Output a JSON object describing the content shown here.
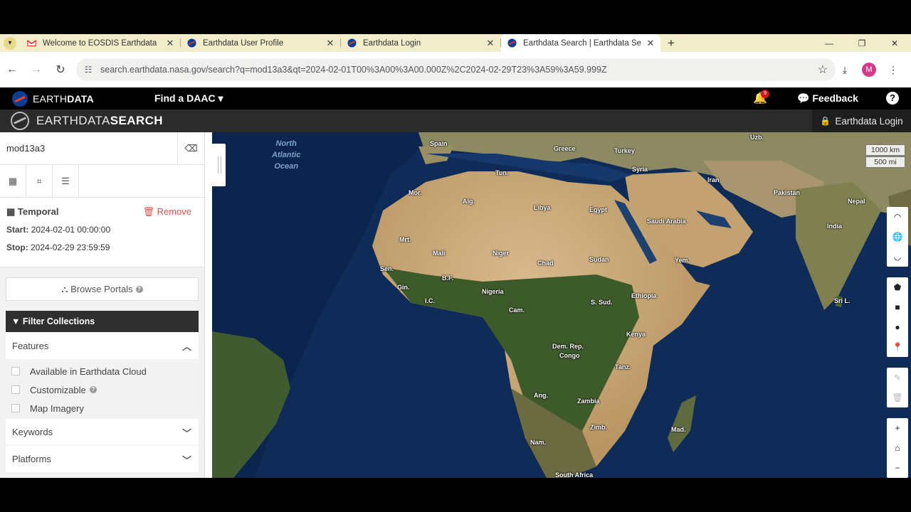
{
  "browser": {
    "tabs": [
      {
        "title": "Welcome to EOSDIS Earthdata",
        "favicon": "gmail-icon",
        "active": false
      },
      {
        "title": "Earthdata User Profile",
        "favicon": "nasa-favicon",
        "active": false
      },
      {
        "title": "Earthdata Login",
        "favicon": "nasa-favicon",
        "active": false
      },
      {
        "title": "Earthdata Search | Earthdata Se",
        "favicon": "nasa-favicon",
        "active": true
      }
    ],
    "url": "search.earthdata.nasa.gov/search?q=mod13a3&qt=2024-02-01T00%3A00%3A00.000Z%2C2024-02-29T23%3A59%3A59.999Z",
    "profile_initial": "M"
  },
  "earthdata_bar": {
    "brand_bold": "EARTH",
    "brand_rest": "DATA",
    "find_daac": "Find a DAAC ▾",
    "notification_count": "9",
    "feedback": "Feedback",
    "help": "?"
  },
  "search_bar": {
    "title_light": "EARTHDATA",
    "title_bold": "SEARCH",
    "login": "Earthdata Login"
  },
  "sidebar": {
    "query": "mod13a3",
    "temporal": {
      "title": "Temporal",
      "remove": "Remove",
      "start_label": "Start:",
      "start": "2024-02-01 00:00:00",
      "stop_label": "Stop:",
      "stop": "2024-02-29 23:59:59"
    },
    "browse_portals": "Browse Portals",
    "filter_title": "Filter Collections",
    "features": {
      "title": "Features",
      "options": [
        "Available in Earthdata Cloud",
        "Customizable",
        "Map Imagery"
      ]
    },
    "keywords": "Keywords",
    "platforms": "Platforms"
  },
  "map": {
    "ocean_label": [
      "North",
      "Atlantic",
      "Ocean"
    ],
    "scale_km": "1000 km",
    "scale_mi": "500 mi",
    "labels": [
      "Spain",
      "Greece",
      "Turkey",
      "Uzb.",
      "Tun.",
      "Syria",
      "Mor.",
      "Alg.",
      "Libya",
      "Egypt",
      "Iran",
      "Pakistan",
      "Nepal",
      "India",
      "Saudi Arabia",
      "Mrt.",
      "Mali",
      "Niger",
      "Chad",
      "Sudan",
      "Yem.",
      "Sen.",
      "B.F.",
      "Gin.",
      "I.C.",
      "Nigeria",
      "Cam.",
      "Ethiopia",
      "S. Sud.",
      "Kenya",
      "Dem. Rep.",
      "Congo",
      "Sri L.",
      "Tanz.",
      "Ang.",
      "Zambia",
      "Zimb.",
      "Mad.",
      "Nam.",
      "South Africa"
    ]
  }
}
